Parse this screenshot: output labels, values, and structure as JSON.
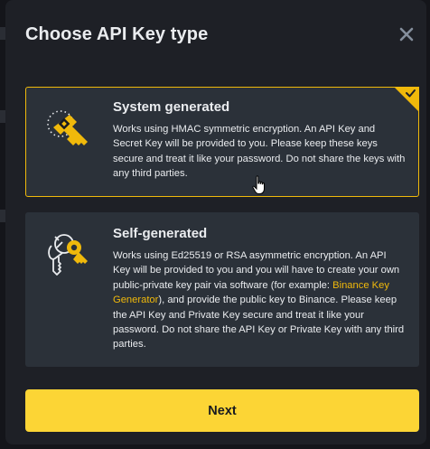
{
  "modal": {
    "title": "Choose API Key type",
    "close_icon": "close-icon"
  },
  "options": [
    {
      "title": "System generated",
      "description": "Works using HMAC symmetric encryption. An API Key and Secret Key will be provided to you. Please keep these keys secure and treat it like your password. Do not share the keys with any third parties.",
      "icon": "key-icon",
      "selected": true
    },
    {
      "title": "Self-generated",
      "description_before_link": "Works using Ed25519 or RSA asymmetric encryption. An API Key will be provided to you and you will have to create your own public-private key pair via software (for example: ",
      "link_text": "Binance Key Generator",
      "description_after_link": "), and provide the public key to Binance. Please keep the API Key and Private Key secure and treat it like your password. Do not share the API Key or Private Key with any third parties.",
      "icon": "keys-icon",
      "selected": false
    }
  ],
  "footer": {
    "next_label": "Next"
  },
  "colors": {
    "accent": "#f0b90b",
    "button": "#fcd535",
    "card": "#2b3139",
    "modal": "#1e2026",
    "text": "#eaecef"
  }
}
